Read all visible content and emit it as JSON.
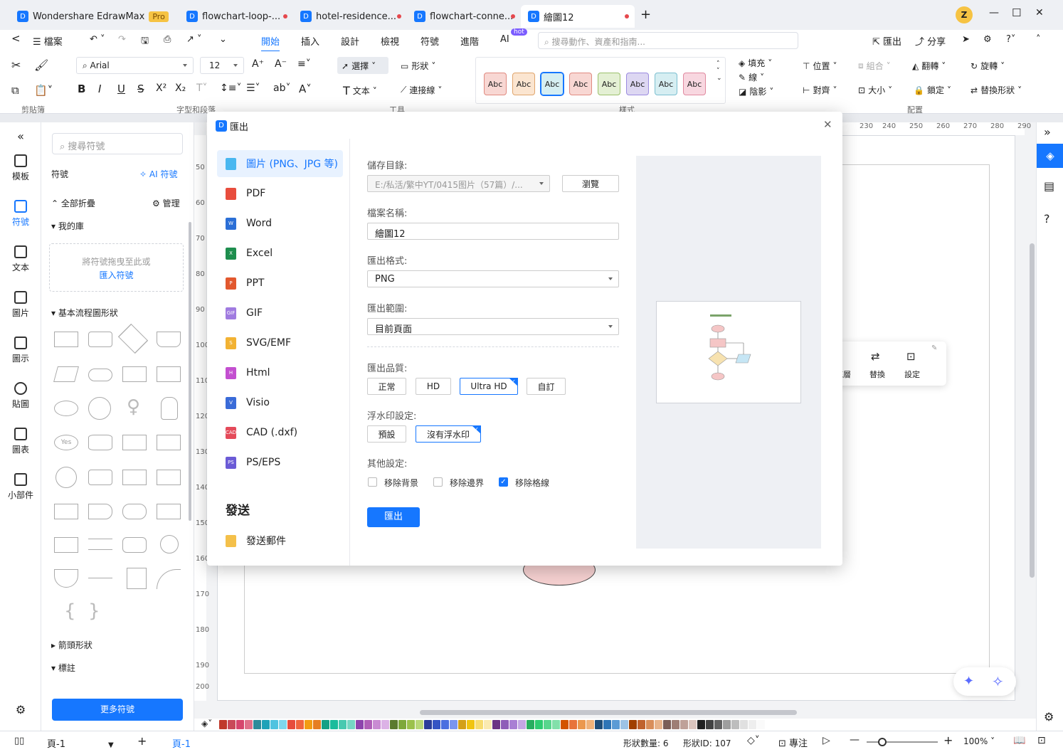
{
  "tabs": [
    {
      "label": "Wondershare EdrawMax",
      "badge": "Pro"
    },
    {
      "label": "flowchart-loop-..."
    },
    {
      "label": "hotel-residence..."
    },
    {
      "label": "flowchart-conne..."
    },
    {
      "label": "繪圖12"
    }
  ],
  "titlebar": {
    "new_tab": "+",
    "avatar": "Z",
    "minimize": "—",
    "maximize": "☐",
    "close": "✕"
  },
  "menu": {
    "back": "<",
    "file": "檔案",
    "items": [
      "開始",
      "插入",
      "設計",
      "檢視",
      "符號",
      "進階",
      "AI"
    ],
    "ai_badge": "hot",
    "search_placeholder": "搜尋動作、資產和指南...",
    "export": "匯出",
    "share": "分享"
  },
  "ribbon": {
    "font": "Arial",
    "size": "12",
    "select": "選擇",
    "shape": "形狀",
    "text": "文本",
    "connector": "連接線",
    "fill": "填充",
    "line": "線",
    "shadow": "陰影",
    "position": "位置",
    "group": "組合",
    "flip": "翻轉",
    "rotate": "旋轉",
    "align": "對齊",
    "size_lbl": "大小",
    "lock": "鎖定",
    "replace_shape": "替換形狀",
    "abc": "Abc",
    "groups": {
      "clipboard": "剪貼簿",
      "font": "字型和段落",
      "tools": "工具",
      "style": "樣式",
      "arrange": "配置"
    }
  },
  "leftnav": [
    "模板",
    "符號",
    "文本",
    "圖片",
    "圖示",
    "貼圖",
    "圖表",
    "小部件"
  ],
  "sympanel": {
    "search_placeholder": "搜尋符號",
    "title": "符號",
    "ai_symbol": "AI 符號",
    "collapse_all": "全部折疊",
    "manage": "管理",
    "my_library": "我的庫",
    "drop_hint": "將符號拖曳至此或",
    "import": "匯入符號",
    "basic_flow": "基本流程圖形狀",
    "arrows": "箭頭形狀",
    "callouts": "標註",
    "more": "更多符號",
    "yes": "Yes"
  },
  "ruler": {
    "top": [
      "230",
      "240",
      "250",
      "260",
      "270",
      "280",
      "290"
    ],
    "left": [
      "50",
      "60",
      "70",
      "80",
      "90",
      "100",
      "110",
      "120",
      "130",
      "140",
      "150",
      "160",
      "170",
      "180",
      "190",
      "200"
    ]
  },
  "floating": {
    "replace": "替換",
    "settings": "設定",
    "layer": "底層"
  },
  "dialog": {
    "title": "匯出",
    "close": "✕",
    "formats": [
      "圖片 (PNG、JPG 等)",
      "PDF",
      "Word",
      "Excel",
      "PPT",
      "GIF",
      "SVG/EMF",
      "Html",
      "Visio",
      "CAD (.dxf)",
      "PS/EPS"
    ],
    "format_icons": [
      "",
      "",
      "W",
      "X",
      "P",
      "GIF",
      "S",
      "H",
      "V",
      "CAD",
      "PS"
    ],
    "send_title": "發送",
    "send_mail": "發送郵件",
    "save_dir_label": "儲存目錄:",
    "save_dir": "E:/私活/繁中YT/0415图片（57篇）/...",
    "browse": "瀏覽",
    "filename_label": "檔案名稱:",
    "filename": "繪圖12",
    "format_label": "匯出格式:",
    "format_value": "PNG",
    "range_label": "匯出範圍:",
    "range_value": "目前頁面",
    "quality_label": "匯出品質:",
    "quality": [
      "正常",
      "HD",
      "Ultra HD",
      "自訂"
    ],
    "watermark_label": "浮水印設定:",
    "watermark": [
      "預設",
      "沒有浮水印"
    ],
    "other_label": "其他設定:",
    "other": [
      "移除背景",
      "移除邊界",
      "移除格線"
    ],
    "export_btn": "匯出"
  },
  "status": {
    "page_selector": "頁-1",
    "add": "+",
    "page_tab": "頁-1",
    "shape_count": "形狀數量: 6",
    "shape_id": "形狀ID: 107",
    "focus": "專注",
    "zoom": "100%"
  },
  "colors": [
    "#c0392b",
    "#c94a59",
    "#d6466d",
    "#e0708a",
    "#2e8b9a",
    "#1fa2b8",
    "#4fc3e0",
    "#7fd6ec",
    "#e74c3c",
    "#f0653e",
    "#f39c12",
    "#e67e22",
    "#16a085",
    "#1abc9c",
    "#48c9b0",
    "#76d7c4",
    "#8e44ad",
    "#b05fb8",
    "#c98bd3",
    "#dcb2e6",
    "#5b7a2e",
    "#7ea83a",
    "#9cc14c",
    "#b9d878",
    "#2c3e99",
    "#3554c4",
    "#4a6fe0",
    "#7a95f0",
    "#d4a017",
    "#f1c40f",
    "#f7dc6f",
    "#faeab0",
    "#6c3483",
    "#8e5cb8",
    "#a97fd4",
    "#c3a6e4",
    "#27ae60",
    "#2ecc71",
    "#58d68d",
    "#82e0aa",
    "#d35400",
    "#e8743b",
    "#eb984e",
    "#f0b27a",
    "#1f4e79",
    "#2e75b6",
    "#5b9bd5",
    "#9dc3e6",
    "#a04000",
    "#c0622d",
    "#d98e5a",
    "#e8b38a",
    "#7b5e57",
    "#9e7e75",
    "#bfa199",
    "#dcc5be",
    "#212121",
    "#424242",
    "#616161",
    "#9e9e9e",
    "#bdbdbd",
    "#e0e0e0",
    "#eeeeee",
    "#fafafa"
  ]
}
